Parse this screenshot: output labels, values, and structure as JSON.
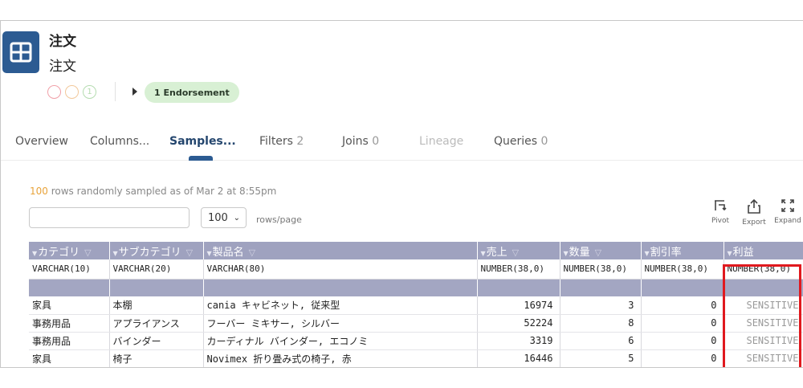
{
  "header": {
    "title": "注文",
    "subtitle": "注文",
    "status_circle_third_label": "1",
    "endorsement_label": "1 Endorsement"
  },
  "colors": {
    "brand": "#2c5b92",
    "table_header": "#9fa2bf",
    "highlight": "#e0191e",
    "endorsement_bg": "#d8f0d4",
    "accent_count": "#e8a33a"
  },
  "tabs": [
    {
      "label": "Overview",
      "count": ""
    },
    {
      "label": "Columns...",
      "count": ""
    },
    {
      "label": "Samples...",
      "count": "",
      "active": true
    },
    {
      "label": "Filters",
      "count": "2"
    },
    {
      "label": "Joins",
      "count": "0"
    },
    {
      "label": "Lineage",
      "count": "",
      "disabled": true
    },
    {
      "label": "Queries",
      "count": "0"
    }
  ],
  "samples": {
    "row_count": "100",
    "info_text": "rows randomly sampled as of Mar 2 at 8:55pm",
    "search_value": "",
    "rows_per_page_value": "100",
    "rows_per_page_label": "rows/page"
  },
  "toolbar": {
    "pivot_label": "Pivot",
    "export_label": "Export",
    "expand_label": "Expand"
  },
  "table": {
    "columns": [
      {
        "name": "カテゴリ",
        "type": "VARCHAR(10)"
      },
      {
        "name": "サブカテゴリ",
        "type": "VARCHAR(20)"
      },
      {
        "name": "製品名",
        "type": "VARCHAR(80)"
      },
      {
        "name": "売上",
        "type": "NUMBER(38,0)"
      },
      {
        "name": "数量",
        "type": "NUMBER(38,0)"
      },
      {
        "name": "割引率",
        "type": "NUMBER(38,0)"
      },
      {
        "name": "利益",
        "type": "NUMBER(38,0)"
      }
    ],
    "rows": [
      [
        "家具",
        "本棚",
        "cania キャビネット, 従来型",
        "16974",
        "3",
        "0",
        "SENSITIVE"
      ],
      [
        "事務用品",
        "アプライアンス",
        "フーバー ミキサー, シルバー",
        "52224",
        "8",
        "0",
        "SENSITIVE"
      ],
      [
        "事務用品",
        "バインダー",
        "カーディナル バインダー, エコノミ",
        "3319",
        "6",
        "0",
        "SENSITIVE"
      ],
      [
        "家具",
        "椅子",
        "Novimex 折り畳み式の椅子, 赤",
        "16446",
        "5",
        "0",
        "SENSITIVE"
      ]
    ]
  }
}
